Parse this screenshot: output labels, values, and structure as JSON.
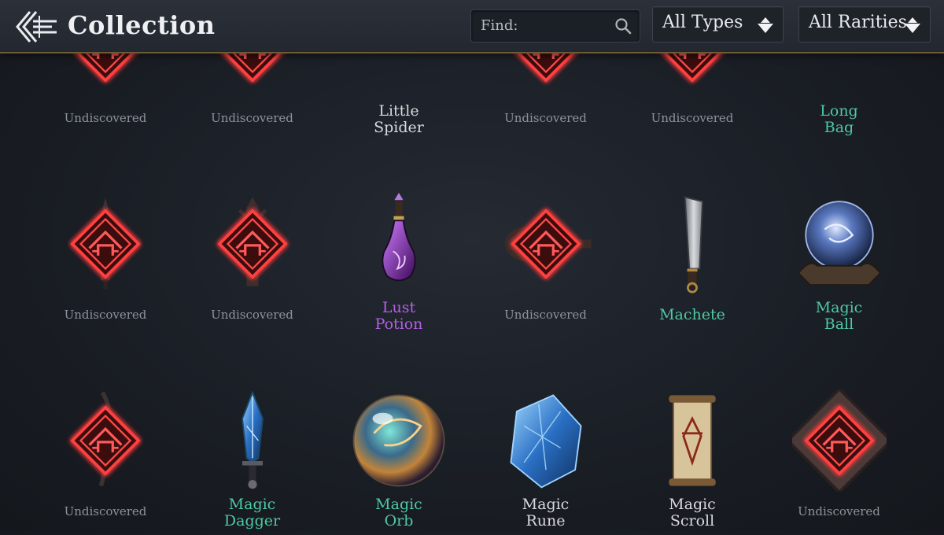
{
  "header": {
    "title": "Collection",
    "search_label": "Find:",
    "search_value": "",
    "type_filter": "All Types",
    "rarity_filter": "All Rarities"
  },
  "colors": {
    "accent_gold": "#6b5a34",
    "rarity_common": "#d7d9dc",
    "rarity_uncommon": "#4ec9a3",
    "rarity_epic": "#b45ee6",
    "undiscovered": "#8d939b",
    "undiscovered_glow": "#ff3b3b"
  },
  "items": [
    {
      "name": "Undiscovered",
      "lines": [
        "Undiscovered"
      ],
      "rarity": "undisc",
      "icon": "locked-box-icon",
      "row": 0,
      "col": 0
    },
    {
      "name": "Undiscovered",
      "lines": [
        "Undiscovered"
      ],
      "rarity": "undisc",
      "icon": "locked-lantern-icon",
      "row": 0,
      "col": 1
    },
    {
      "name": "Little Spider",
      "lines": [
        "Little",
        "Spider"
      ],
      "rarity": "common",
      "icon": "spider-icon",
      "row": 0,
      "col": 2
    },
    {
      "name": "Undiscovered",
      "lines": [
        "Undiscovered"
      ],
      "rarity": "undisc",
      "icon": "locked-item-icon",
      "row": 0,
      "col": 3
    },
    {
      "name": "Undiscovered",
      "lines": [
        "Undiscovered"
      ],
      "rarity": "undisc",
      "icon": "locked-item-icon",
      "row": 0,
      "col": 4
    },
    {
      "name": "Long Bag",
      "lines": [
        "Long",
        "Bag"
      ],
      "rarity": "uncommon",
      "icon": "bag-icon",
      "row": 0,
      "col": 5
    },
    {
      "name": "Undiscovered",
      "lines": [
        "Undiscovered"
      ],
      "rarity": "undisc",
      "icon": "locked-dagger-icon",
      "row": 1,
      "col": 0
    },
    {
      "name": "Undiscovered",
      "lines": [
        "Undiscovered"
      ],
      "rarity": "undisc",
      "icon": "locked-spear-icon",
      "row": 1,
      "col": 1
    },
    {
      "name": "Lust Potion",
      "lines": [
        "Lust",
        "Potion"
      ],
      "rarity": "epic",
      "icon": "potion-icon",
      "row": 1,
      "col": 2
    },
    {
      "name": "Undiscovered",
      "lines": [
        "Undiscovered"
      ],
      "rarity": "undisc",
      "icon": "locked-lute-icon",
      "row": 1,
      "col": 3
    },
    {
      "name": "Machete",
      "lines": [
        "Machete"
      ],
      "rarity": "uncommon",
      "icon": "machete-icon",
      "row": 1,
      "col": 4
    },
    {
      "name": "Magic Ball",
      "lines": [
        "Magic",
        "Ball"
      ],
      "rarity": "uncommon",
      "icon": "crystal-ball-icon",
      "row": 1,
      "col": 5
    },
    {
      "name": "Undiscovered",
      "lines": [
        "Undiscovered"
      ],
      "rarity": "undisc",
      "icon": "locked-blade-icon",
      "row": 2,
      "col": 0
    },
    {
      "name": "Magic Dagger",
      "lines": [
        "Magic",
        "Dagger"
      ],
      "rarity": "uncommon",
      "icon": "crystal-dagger-icon",
      "row": 2,
      "col": 1
    },
    {
      "name": "Magic Orb",
      "lines": [
        "Magic",
        "Orb"
      ],
      "rarity": "uncommon",
      "icon": "orb-icon",
      "row": 2,
      "col": 2
    },
    {
      "name": "Magic Rune",
      "lines": [
        "Magic",
        "Rune"
      ],
      "rarity": "common",
      "icon": "rune-icon",
      "row": 2,
      "col": 3
    },
    {
      "name": "Magic Scroll",
      "lines": [
        "Magic",
        "Scroll"
      ],
      "rarity": "common",
      "icon": "scroll-icon",
      "row": 2,
      "col": 4
    },
    {
      "name": "Undiscovered",
      "lines": [
        "Undiscovered"
      ],
      "rarity": "undisc",
      "icon": "locked-rune-icon",
      "row": 2,
      "col": 5
    }
  ]
}
